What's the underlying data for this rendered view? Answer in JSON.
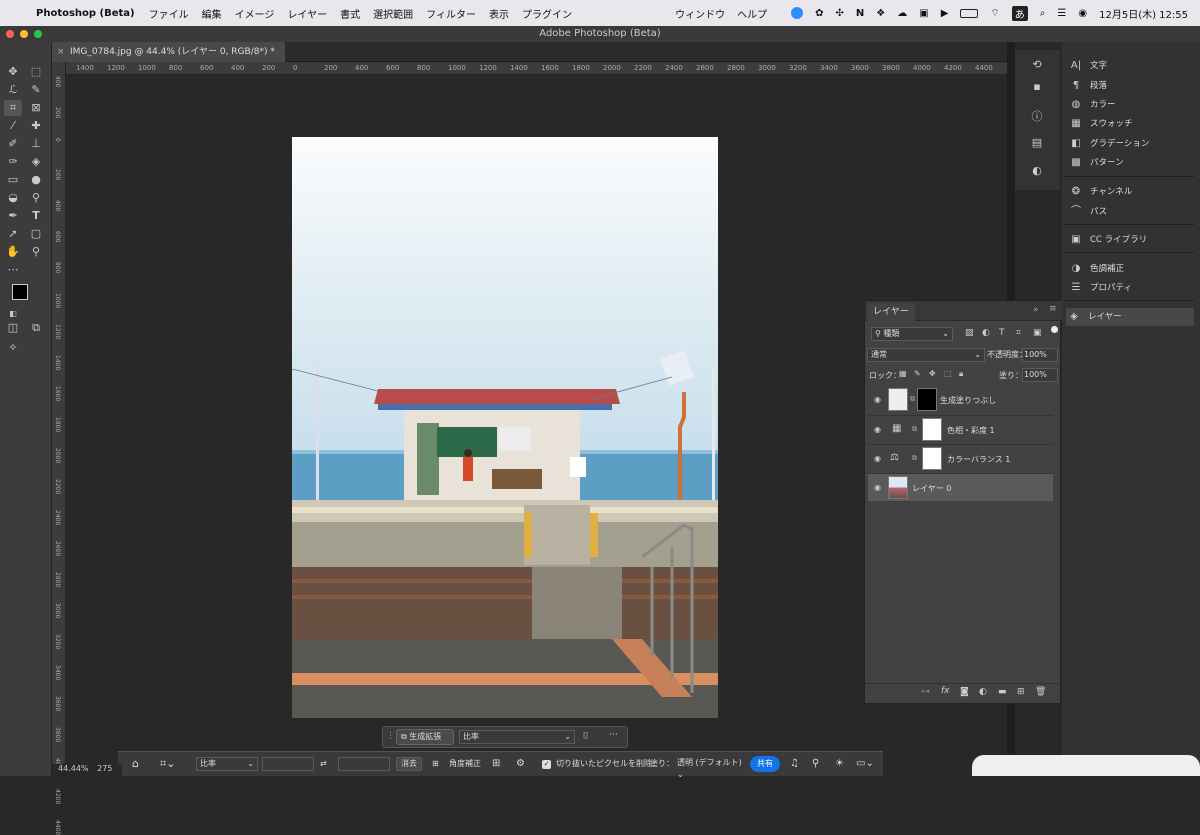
{
  "menubar": {
    "app_name": "Photoshop (Beta)",
    "items": [
      "ファイル",
      "編集",
      "イメージ",
      "レイヤー",
      "書式",
      "選択範囲",
      "フィルター",
      "表示",
      "プラグイン"
    ],
    "right_items": [
      "ウィンドウ",
      "ヘルプ"
    ],
    "clock": "12月5日(木) 12:55",
    "ime": "あ"
  },
  "window": {
    "title": "Adobe Photoshop (Beta)"
  },
  "document_tab": {
    "label": "IMG_0784.jpg @ 44.4% (レイヤー 0, RGB/8*) *"
  },
  "ruler": {
    "h_ticks": [
      "1400",
      "1200",
      "1000",
      "800",
      "600",
      "400",
      "200",
      "0",
      "200",
      "400",
      "600",
      "800",
      "1000",
      "1200",
      "1400",
      "1600",
      "1800",
      "2000",
      "2200",
      "2400",
      "2600",
      "2800",
      "3000",
      "3200",
      "3400",
      "3600",
      "3800",
      "4000",
      "4200",
      "4400"
    ],
    "v_ticks": [
      "400",
      "200",
      "0",
      "200",
      "400",
      "600",
      "800",
      "1000",
      "1200",
      "1400",
      "1600",
      "1800",
      "2000",
      "2200",
      "2400",
      "2600",
      "2800",
      "3000",
      "3200",
      "3400",
      "3600",
      "3800",
      "4000",
      "4200",
      "4400"
    ]
  },
  "right_panel": {
    "items": [
      "文字",
      "段落",
      "カラー",
      "スウォッチ",
      "グラデーション",
      "パターン",
      "チャンネル",
      "パス",
      "CC ライブラリ",
      "色調補正",
      "プロパティ",
      "レイヤー"
    ]
  },
  "layers_panel": {
    "tab": "レイヤー",
    "filter": "種類",
    "blend_mode": "通常",
    "opacity_label": "不透明度：",
    "opacity_value": "100%",
    "lock_label": "ロック：",
    "fill_label": "塗り：",
    "fill_value": "100%",
    "layers": [
      {
        "name": "生成塗りつぶし"
      },
      {
        "name": "色相・彩度 1"
      },
      {
        "name": "カラーバランス 1"
      },
      {
        "name": "レイヤー 0"
      }
    ]
  },
  "context_bar": {
    "generate_button": "生成拡張",
    "ratio_select": "比率"
  },
  "options_bar": {
    "ratio_select": "比率",
    "clear_button": "消去",
    "straighten_label": "角度補正",
    "delete_pixels_label": "切り抜いたピクセルを削除",
    "fill_label": "塗り：",
    "fill_select": "透明 (デフォルト)",
    "share_button": "共有"
  },
  "status": {
    "zoom": "44.44%",
    "info": "275"
  },
  "colors": {
    "accent": "#1473e6",
    "foreground": "#000000",
    "background": "#7a8aa0"
  }
}
